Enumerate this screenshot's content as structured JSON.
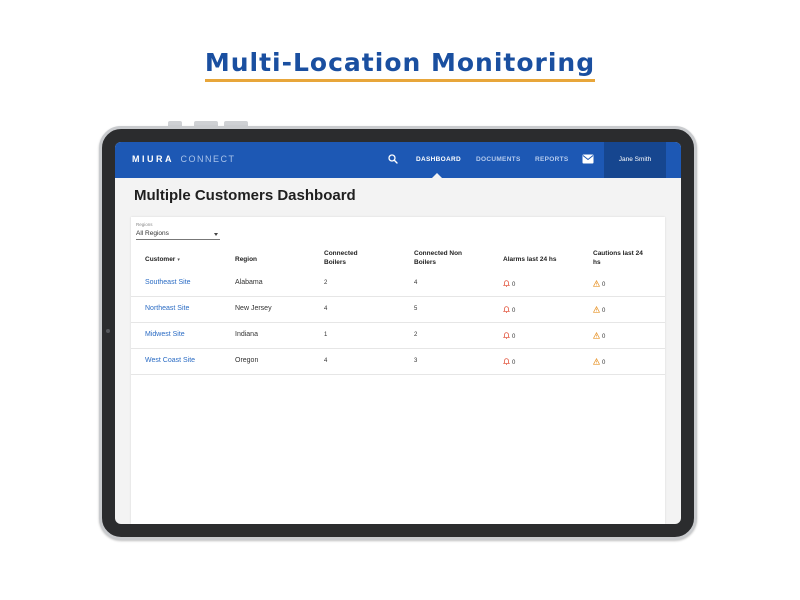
{
  "heading": "Multi-Location Monitoring",
  "colors": {
    "heading": "#1a4fa0",
    "underline": "#e8a63a",
    "navbar": "#1d58b4",
    "user_bg": "#16468f",
    "link": "#2b6cc4",
    "alarm": "#e0452b",
    "caution": "#e8962e"
  },
  "app": {
    "logo_brand": "MIURA",
    "logo_sub": "CONNECT",
    "nav": {
      "search_icon": "search-icon",
      "dashboard": "DASHBOARD",
      "documents": "DOCUMENTS",
      "reports": "REPORTS",
      "mail_icon": "mail-icon",
      "user": "Jane Smith"
    },
    "page_title": "Multiple Customers Dashboard",
    "filter": {
      "label": "Regions",
      "value": "All Regions"
    },
    "table": {
      "headers": {
        "customer": "Customer",
        "region": "Region",
        "connected_line1": "Connected",
        "connected_line2": "Boilers",
        "nonboilers_line1": "Connected Non",
        "nonboilers_line2": "Boilers",
        "alarms": "Alarms last 24 hs",
        "cautions_line1": "Cautions last 24",
        "cautions_line2": "hs"
      },
      "rows": [
        {
          "customer": "Southeast Site",
          "region": "Alabama",
          "boilers": "2",
          "non_boilers": "4",
          "alarms": "0",
          "cautions": "0"
        },
        {
          "customer": "Northeast Site",
          "region": "New Jersey",
          "boilers": "4",
          "non_boilers": "5",
          "alarms": "0",
          "cautions": "0"
        },
        {
          "customer": "Midwest Site",
          "region": "Indiana",
          "boilers": "1",
          "non_boilers": "2",
          "alarms": "0",
          "cautions": "0"
        },
        {
          "customer": "West Coast Site",
          "region": "Oregon",
          "boilers": "4",
          "non_boilers": "3",
          "alarms": "0",
          "cautions": "0"
        }
      ]
    }
  }
}
